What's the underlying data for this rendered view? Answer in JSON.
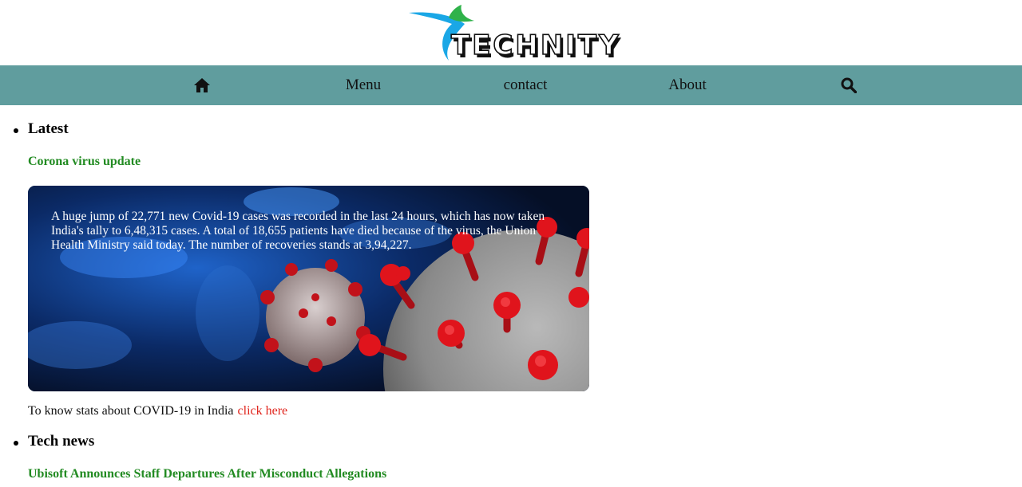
{
  "header": {
    "logo_name": "TECHNITY",
    "logo_colors": {
      "bird_blue": "#1aa7e6",
      "bird_green": "#2fb24a",
      "text": "#111111"
    }
  },
  "nav": {
    "home_icon": "home-icon",
    "items": [
      {
        "label": "Menu"
      },
      {
        "label": "contact"
      },
      {
        "label": "About"
      }
    ],
    "search_icon": "search-icon",
    "background": "#609d9e"
  },
  "sections": [
    {
      "heading": "Latest",
      "article_title": "Corona virus update",
      "card_text": "A huge jump of 22,771 new Covid-19 cases was recorded in the last 24 hours, which has now taken India's tally to 6,48,315 cases. A total of 18,655 patients have died because of the virus, the Union Health Ministry said today. The number of recoveries stands at 3,94,227.",
      "stats_text": "To know stats about COVID-19 in India",
      "stats_link": "click here"
    },
    {
      "heading": "Tech news",
      "article_title": "Ubisoft Announces Staff Departures After Misconduct Allegations"
    }
  ],
  "colors": {
    "title_green": "#228b22",
    "link_red": "#e0241c"
  }
}
